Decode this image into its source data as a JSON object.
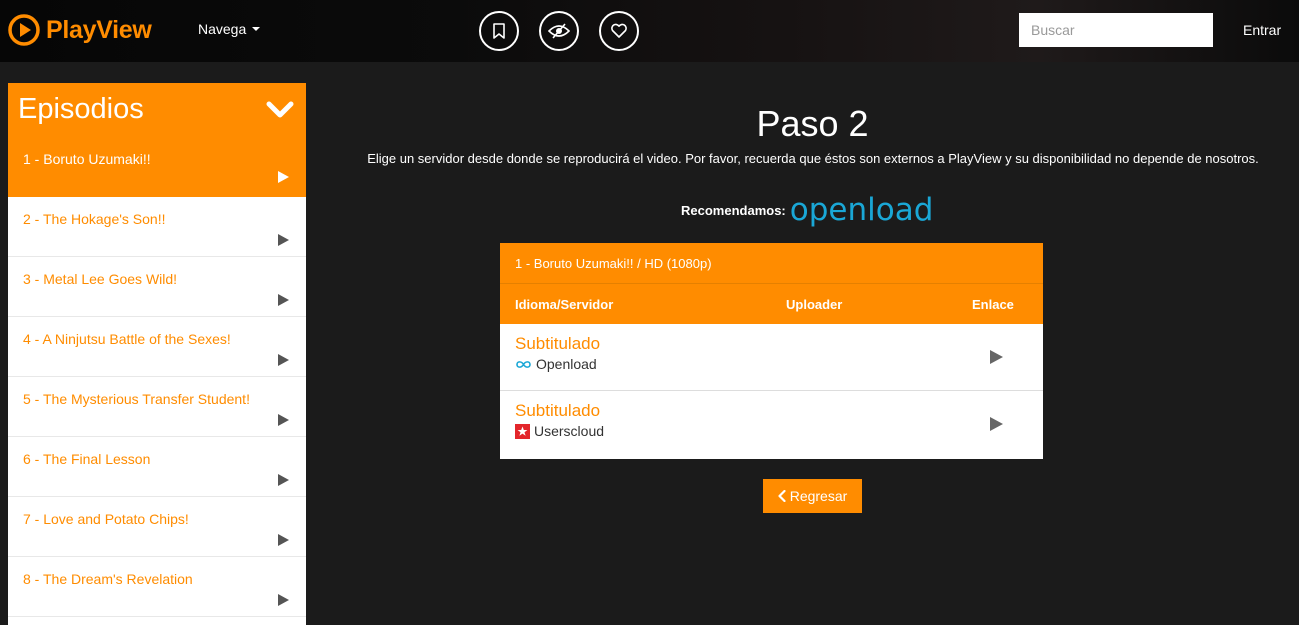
{
  "header": {
    "brand": "PlayView",
    "nav_label": "Navega",
    "icons": [
      "bookmark-icon",
      "eye-slash-icon",
      "heart-icon"
    ],
    "search_placeholder": "Buscar",
    "login_label": "Entrar"
  },
  "sidebar": {
    "title": "Episodios",
    "episodes": [
      {
        "label": "1 - Boruto Uzumaki!!",
        "active": true
      },
      {
        "label": "2 - The Hokage's Son!!"
      },
      {
        "label": "3 - Metal Lee Goes Wild!"
      },
      {
        "label": "4 - A Ninjutsu Battle of the Sexes!"
      },
      {
        "label": "5 - The Mysterious Transfer Student!"
      },
      {
        "label": "6 - The Final Lesson"
      },
      {
        "label": "7 - Love and Potato Chips!"
      },
      {
        "label": "8 - The Dream's Revelation"
      }
    ]
  },
  "main": {
    "title": "Paso 2",
    "description": "Elige un servidor desde donde se reproducirá el video. Por favor, recuerda que éstos son externos a PlayView y su disponibilidad no depende de nosotros.",
    "recommend_label": "Recomendamos:",
    "recommend_brand": "openload",
    "table": {
      "title": "1 - Boruto Uzumaki!! / HD (1080p)",
      "col_lang": "Idioma/Servidor",
      "col_uploader": "Uploader",
      "col_link": "Enlace",
      "rows": [
        {
          "lang": "Subtitulado",
          "server": "Openload",
          "icon": "infinity-icon"
        },
        {
          "lang": "Subtitulado",
          "server": "Userscloud",
          "icon": "star-icon"
        }
      ]
    },
    "back_label": "Regresar"
  },
  "colors": {
    "accent": "#ff8c00",
    "background": "#1b1b1b",
    "openload": "#1aa7d6"
  }
}
